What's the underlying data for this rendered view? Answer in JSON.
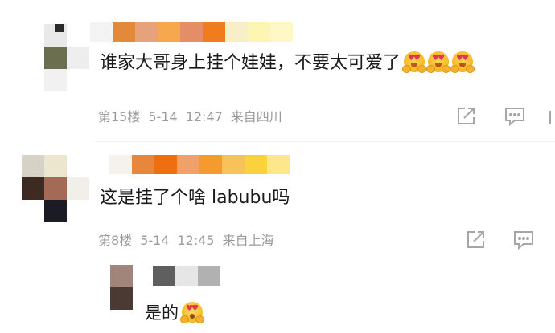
{
  "comments": [
    {
      "text": "谁家大哥身上挂个娃娃，不要太可爱了",
      "emojis": [
        "heart-eyes-emoji",
        "heart-eyes-emoji",
        "heart-eyes-emoji"
      ],
      "floor": "第15楼",
      "date": "5-14",
      "time": "12:47",
      "location": "来自四川"
    },
    {
      "text": "这是挂了个啥 labubu吗",
      "floor": "第8楼",
      "date": "5-14",
      "time": "12:45",
      "location": "来自上海"
    }
  ],
  "reply": {
    "text": "是的",
    "emoji": "pleading-face-emoji"
  },
  "icons": {
    "reply": "edit-reply-icon",
    "comment": "comment-bubble-icon"
  },
  "colors": {
    "text": "#1a1a1a",
    "meta": "#9a9a9a",
    "icon": "#a6a6a6"
  }
}
